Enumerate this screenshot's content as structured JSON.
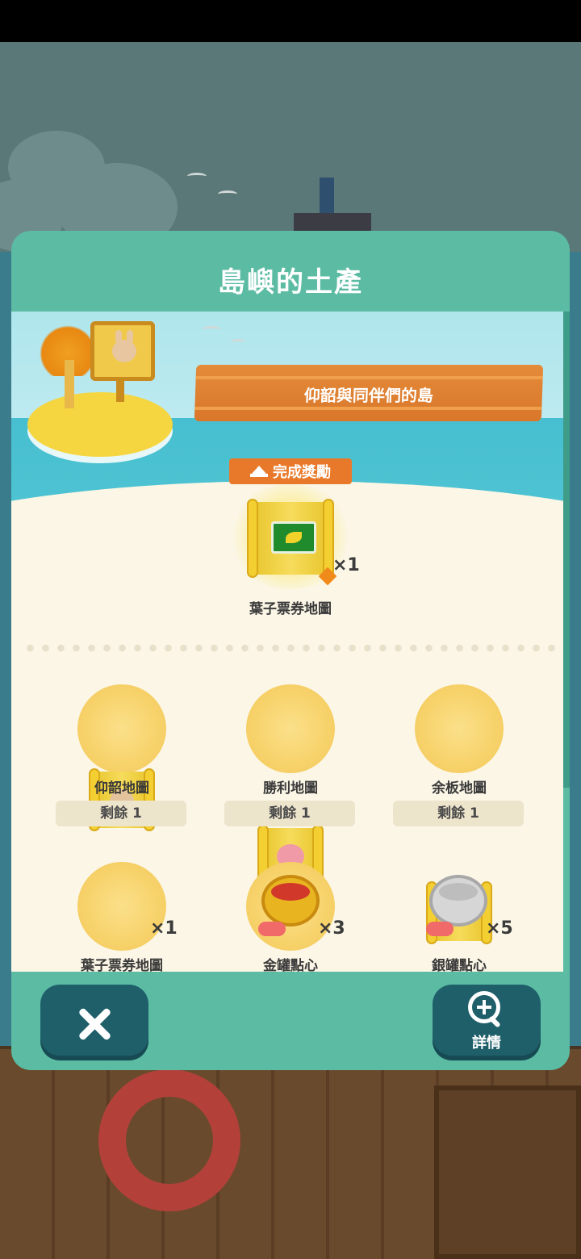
{
  "dialog": {
    "title": "島嶼的土產",
    "island_name": "仰韶與同伴們的島",
    "reward_tag": "完成獎勵"
  },
  "completion_reward": {
    "name": "葉子票券地圖",
    "qty": "×1",
    "icon": "leaf-ticket-map-icon"
  },
  "items": [
    {
      "name": "仰韶地圖",
      "remaining": "剩餘 1",
      "icon": "bunny-map-icon"
    },
    {
      "name": "勝利地圖",
      "remaining": "剩餘 1",
      "icon": "pig-map-icon"
    },
    {
      "name": "余板地圖",
      "remaining": "剩餘 1",
      "icon": "bird-map-icon"
    },
    {
      "name": "葉子票券地圖",
      "qty": "×1",
      "icon": "leaf-ticket-map-icon"
    },
    {
      "name": "金罐點心",
      "qty": "×3",
      "icon": "gold-can-snack-icon"
    },
    {
      "name": "銀罐點心",
      "qty": "×5",
      "icon": "silver-can-snack-icon"
    }
  ],
  "footer": {
    "close_icon": "close-icon",
    "detail_label": "詳情",
    "detail_icon": "zoom-in-icon"
  },
  "colors": {
    "panel": "#5bbba3",
    "content_bg": "#fbf6e6",
    "accent_orange": "#e9792a",
    "footer_button": "#1e5f6a"
  }
}
